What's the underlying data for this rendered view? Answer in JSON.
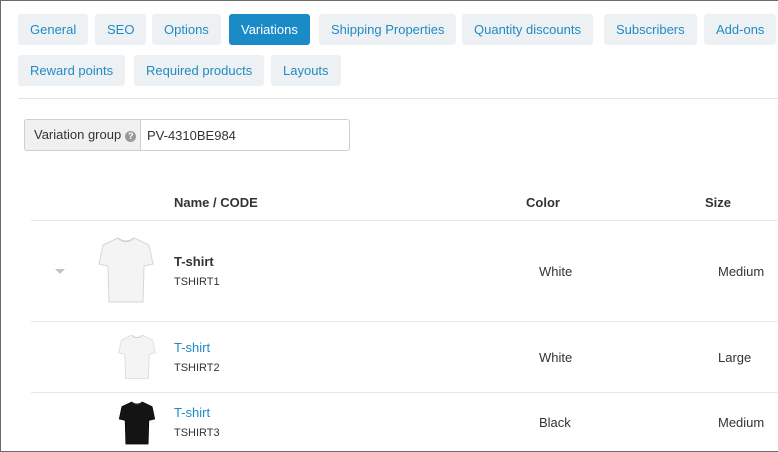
{
  "tabs": [
    {
      "label": "General",
      "active": false
    },
    {
      "label": "SEO",
      "active": false
    },
    {
      "label": "Options",
      "active": false
    },
    {
      "label": "Variations",
      "active": true
    },
    {
      "label": "Shipping Properties",
      "active": false
    },
    {
      "label": "Quantity discounts",
      "active": false
    },
    {
      "label": "Subscribers",
      "active": false
    },
    {
      "label": "Add-ons",
      "active": false
    },
    {
      "label": "Reward points",
      "active": false
    },
    {
      "label": "Required products",
      "active": false
    },
    {
      "label": "Layouts",
      "active": false
    }
  ],
  "variation_group": {
    "label": "Variation group",
    "value": "PV-4310BE984"
  },
  "table": {
    "headers": {
      "name": "Name / CODE",
      "color": "Color",
      "size": "Size"
    },
    "rows": [
      {
        "name": "T-shirt",
        "code": "TSHIRT1",
        "color": "White",
        "size": "Medium",
        "shirt_color": "white",
        "is_parent": true
      },
      {
        "name": "T-shirt",
        "code": "TSHIRT2",
        "color": "White",
        "size": "Large",
        "shirt_color": "white",
        "is_parent": false
      },
      {
        "name": "T-shirt",
        "code": "TSHIRT3",
        "color": "Black",
        "size": "Medium",
        "shirt_color": "black",
        "is_parent": false
      }
    ]
  },
  "colors": {
    "accent": "#1a8bc7",
    "link": "#1f8bc5",
    "tab_bg": "#eef1f3"
  }
}
